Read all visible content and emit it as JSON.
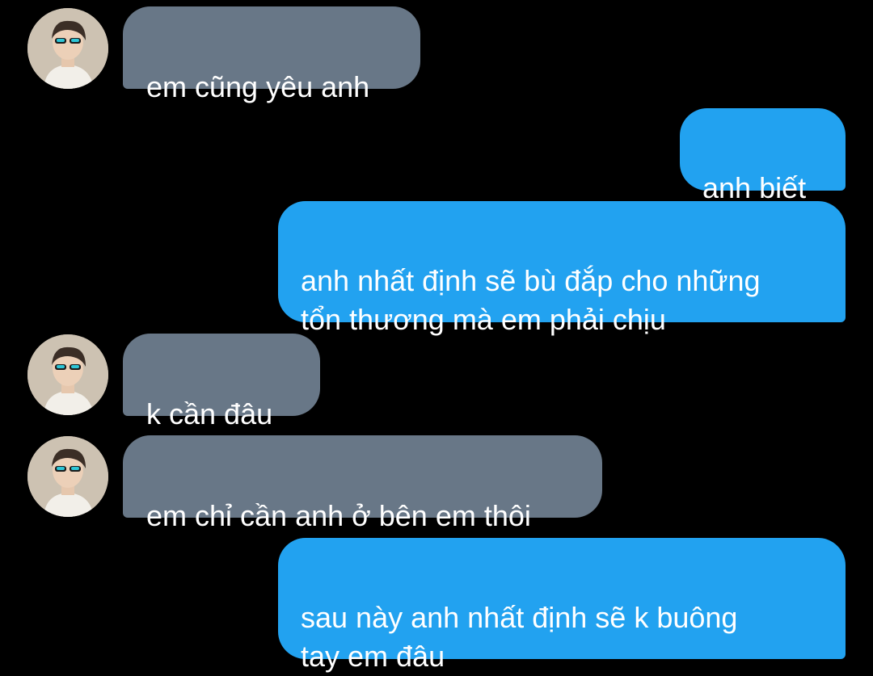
{
  "conversation": {
    "messages": [
      {
        "sender": "other",
        "avatar": "profile-photo",
        "text": "em cũng yêu anh"
      },
      {
        "sender": "me",
        "text": "anh biết"
      },
      {
        "sender": "me",
        "text": "anh nhất định sẽ bù đắp cho những\ntổn thương mà em phải chịu"
      },
      {
        "sender": "other",
        "avatar": "profile-photo",
        "text": "k cần đâu"
      },
      {
        "sender": "other",
        "avatar": "profile-photo",
        "text": "em chỉ cần anh ở bên em thôi"
      },
      {
        "sender": "me",
        "text": "sau này anh nhất định sẽ k buông\ntay em đâu"
      }
    ]
  },
  "colors": {
    "background": "#000000",
    "incoming_bubble": "#687787",
    "outgoing_bubble": "#22a2f0",
    "text": "#ffffff"
  }
}
